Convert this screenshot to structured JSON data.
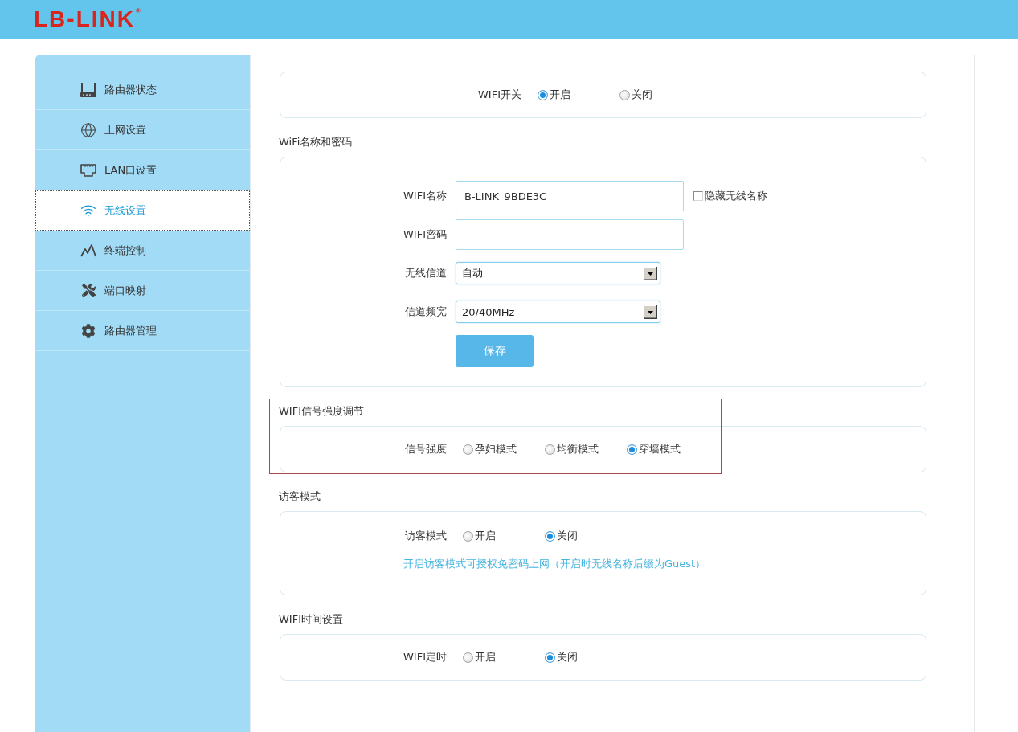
{
  "header": {
    "logo": "LB-LINK$^{®}$"
  },
  "sidebar": {
    "items": [
      {
        "label": "路由器状态",
        "selected": false
      },
      {
        "label": "上网设置",
        "selected": false
      },
      {
        "label": "LAN口设置",
        "selected": false
      },
      {
        "label": "无线设置",
        "selected": true
      },
      {
        "label": "终端控制",
        "selected": false
      },
      {
        "label": "端口映射",
        "selected": false
      },
      {
        "label": "路由器管理",
        "selected": false
      }
    ]
  },
  "sections": [
    {
      "highlighted": false,
      "rows": [
        {
          "kind": "radio",
          "label": "WIFI开关",
          "options": [
            {
              "label": "开启",
              "selected": true
            },
            {
              "label": "关闭",
              "selected": false
            }
          ]
        }
      ]
    },
    {
      "heading": "WiFi名称和密码",
      "highlighted": false,
      "rows": [
        {
          "kind": "text",
          "label": "WIFI名称",
          "value": "B-LINK_9BDE3C",
          "checkbox": {
            "label": "隐藏无线名称",
            "checked": false
          }
        },
        {
          "kind": "password",
          "label": "WIFI密码"
        },
        {
          "kind": "select",
          "label": "无线信道",
          "value": "自动"
        },
        {
          "kind": "select",
          "label": "信道频宽",
          "value": "20/40MHz"
        },
        {
          "kind": "button",
          "label": "保存"
        }
      ]
    },
    {
      "heading": "WIFI信号强度调节",
      "highlighted": true,
      "rows": [
        {
          "kind": "radio",
          "label": "信号强度",
          "options": [
            {
              "label": "孕妇模式",
              "selected": false
            },
            {
              "label": "均衡模式",
              "selected": false
            },
            {
              "label": "穿墙模式",
              "selected": true
            }
          ]
        }
      ]
    },
    {
      "heading": "访客模式",
      "highlighted": false,
      "rows": [
        {
          "kind": "radio",
          "label": "访客模式",
          "options": [
            {
              "label": "开启",
              "selected": false
            },
            {
              "label": "关闭",
              "selected": true
            }
          ]
        },
        {
          "kind": "hint",
          "text": "开启访客模式可授权免密码上网（开启时无线名称后缀为Guest）"
        }
      ]
    },
    {
      "heading": "WIFI时间设置",
      "highlighted": false,
      "rows": [
        {
          "kind": "radio",
          "label": "WIFI定时",
          "options": [
            {
              "label": "开启",
              "selected": false
            },
            {
              "label": "关闭",
              "selected": true
            }
          ]
        }
      ]
    }
  ]
}
